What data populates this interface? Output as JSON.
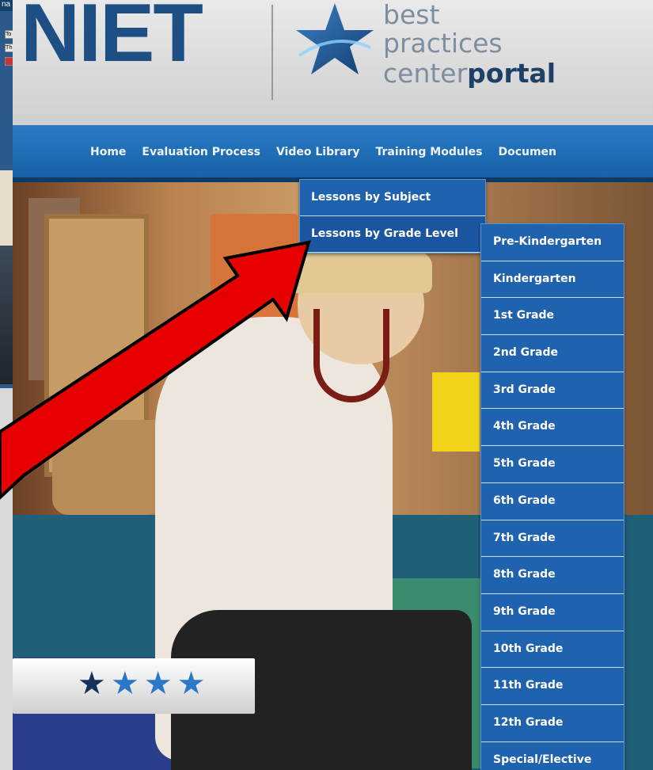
{
  "background_window": {
    "title_fragment": "na",
    "btn1": "To",
    "btn2": "The"
  },
  "logo": {
    "wordmark": "NIET",
    "tag_line1": "best",
    "tag_line2": "practices",
    "tag_line3_plain": "center",
    "tag_line3_bold": "portal"
  },
  "nav": {
    "items": [
      "Home",
      "Evaluation Process",
      "Video Library",
      "Training Modules",
      "Documen"
    ]
  },
  "video_menu": {
    "items": [
      "Lessons by Subject",
      "Lessons by Grade Level"
    ]
  },
  "grade_menu": {
    "items": [
      "Pre-Kindergarten",
      "Kindergarten",
      "1st Grade",
      "2nd Grade",
      "3rd Grade",
      "4th Grade",
      "5th Grade",
      "6th Grade",
      "7th Grade",
      "8th Grade",
      "9th Grade",
      "10th Grade",
      "11th Grade",
      "12th Grade",
      "Special/Elective"
    ]
  },
  "rating": {
    "filled": 1,
    "total": 4
  },
  "colors": {
    "nav_blue": "#1f6bb5",
    "menu_blue": "#1f62ae",
    "brand_dark": "#1d4f85",
    "arrow_red": "#e60000"
  }
}
